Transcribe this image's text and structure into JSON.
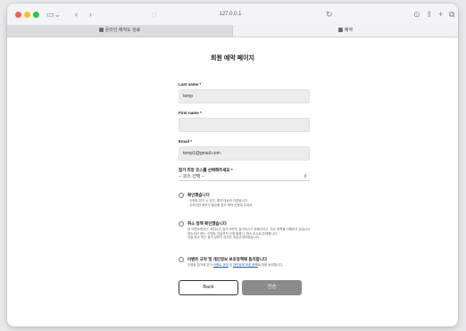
{
  "browser": {
    "url": "127.0.0.1",
    "tabs": [
      {
        "label": "온라인 예약도 완료"
      },
      {
        "label": "예약"
      }
    ]
  },
  "page": {
    "title": "회원 예약 페이지"
  },
  "form": {
    "last_name": {
      "label": "Last name *",
      "value": "temp"
    },
    "first_name": {
      "label": "First name *",
      "value": ""
    },
    "email": {
      "label": "Email *",
      "value": "temp1@gmail.com"
    },
    "course": {
      "label": "참가 희망 코스를 선택해주세요 *",
      "selected": "-- 코스 선택 --"
    },
    "consents": [
      {
        "title": "확인했습니다",
        "desc": "- 이벤트 참가 시 본인, 예약 대상과 관련됩니다.\n- 주최관련 정보가 필요할 경우 예약 신청에 주세요."
      },
      {
        "title": "취소 정책 확인했습니다",
        "desc": "본 이벤트에서는, 회의수신 등의 모든이 참가하시기 위해서이고, 취소 정책을 이해하고 있습니다.\n취소처리 게는, 이벤트 전날까지 신청 블록시, 취소 수수료 존재합니다.\n당일 취소 또는 결석 정보가 관리는 취급관계하였습니다."
      },
      {
        "title": "이벤트 규약 및 개인정보 보호정책에 동의합니다",
        "desc_prefix": "이벤트 참가에 있어 ",
        "link1": "이벤트 규약",
        "desc_mid": " 및 ",
        "link2": "개인정보 보호 정책",
        "desc_suffix": "에 대한 동의합니다."
      }
    ]
  },
  "buttons": {
    "back": "Back",
    "confirm": "전송"
  }
}
